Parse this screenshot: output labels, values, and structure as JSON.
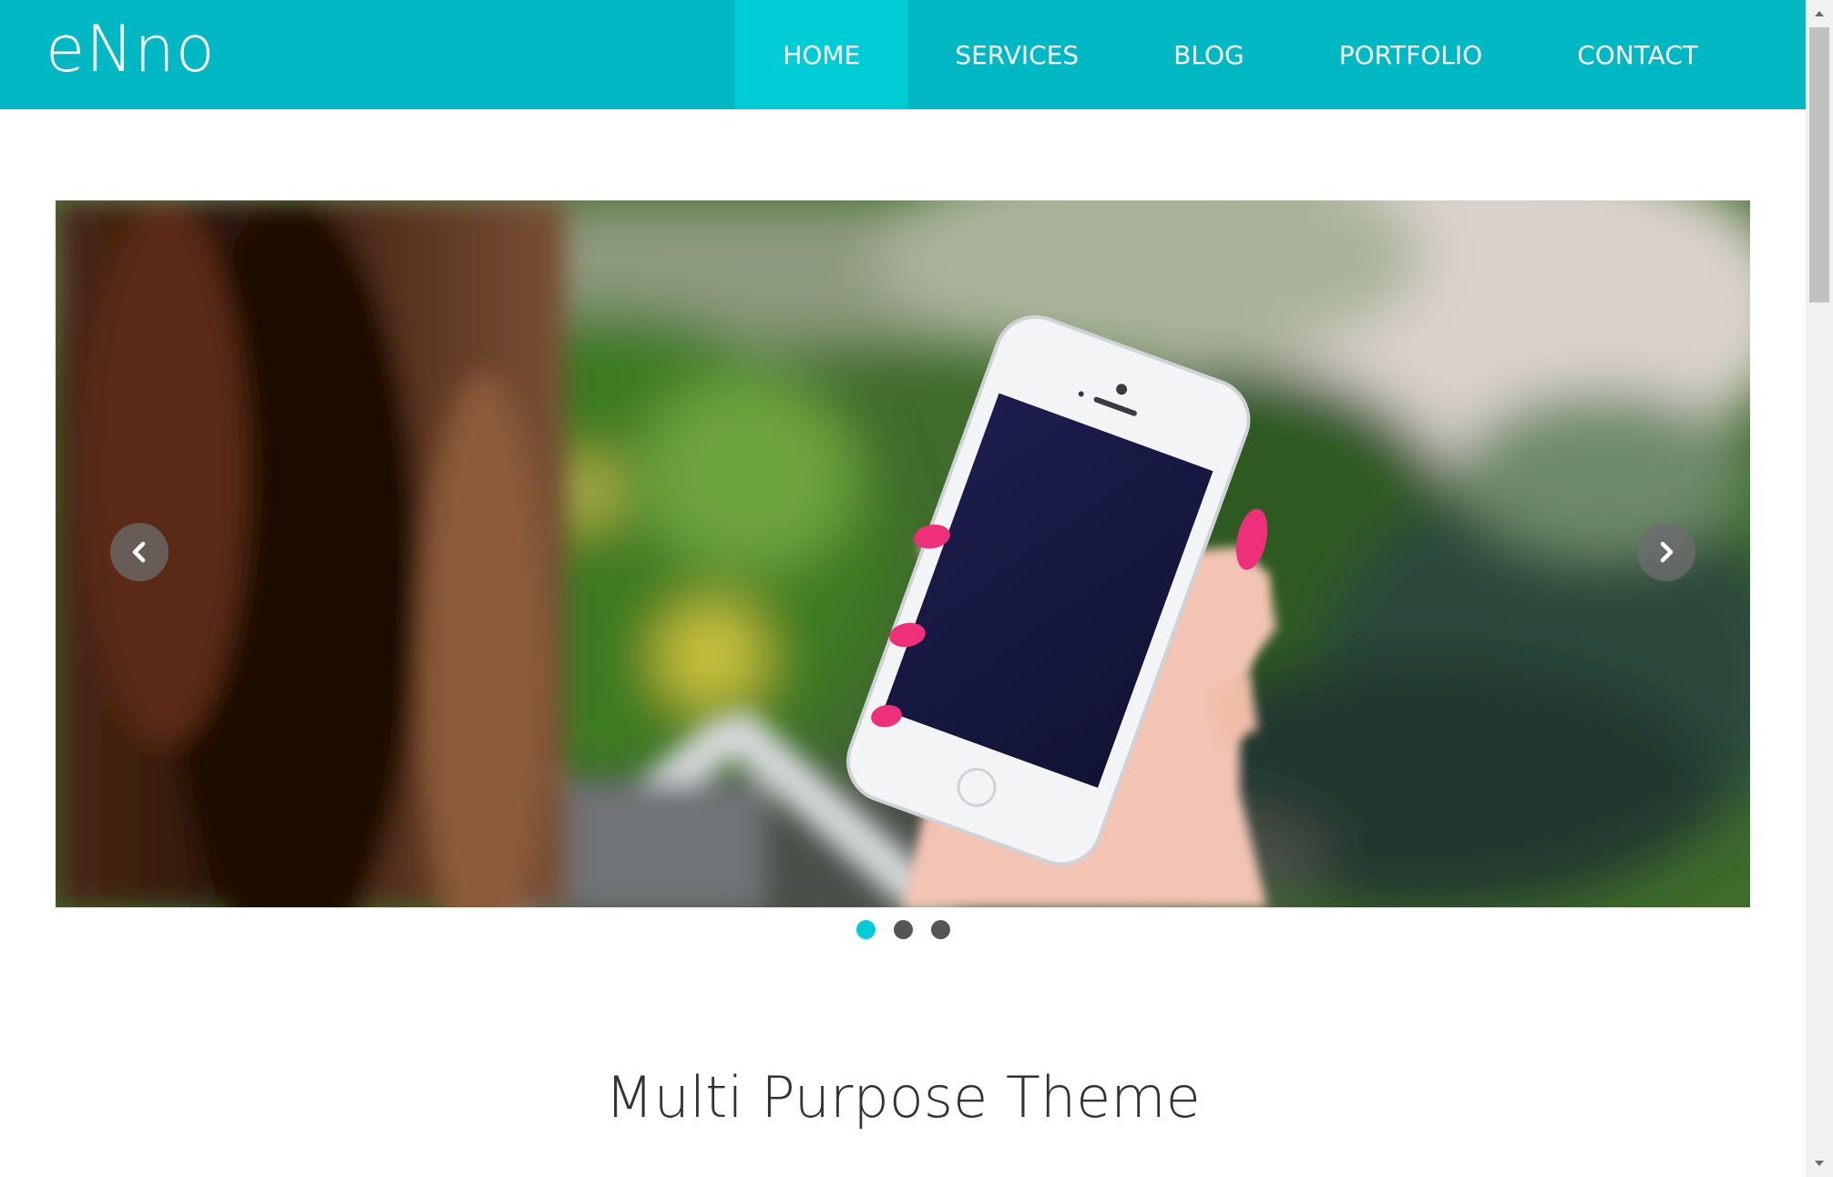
{
  "brand": {
    "logo_text": "eNno"
  },
  "nav": {
    "items": [
      {
        "label": "HOME",
        "active": true
      },
      {
        "label": "SERVICES",
        "active": false
      },
      {
        "label": "BLOG",
        "active": false
      },
      {
        "label": "PORTFOLIO",
        "active": false
      },
      {
        "label": "CONTACT",
        "active": false
      }
    ]
  },
  "slider": {
    "prev_icon": "chevron-left-icon",
    "next_icon": "chevron-right-icon",
    "slide_count": 3,
    "active_slide": 1
  },
  "main": {
    "section_title": "Multi Purpose Theme"
  },
  "colors": {
    "header": "#00b8c3",
    "nav_active": "#00ccd6",
    "dot_active": "#00ccd6",
    "dot_inactive": "#555555",
    "title_text": "#333333"
  }
}
